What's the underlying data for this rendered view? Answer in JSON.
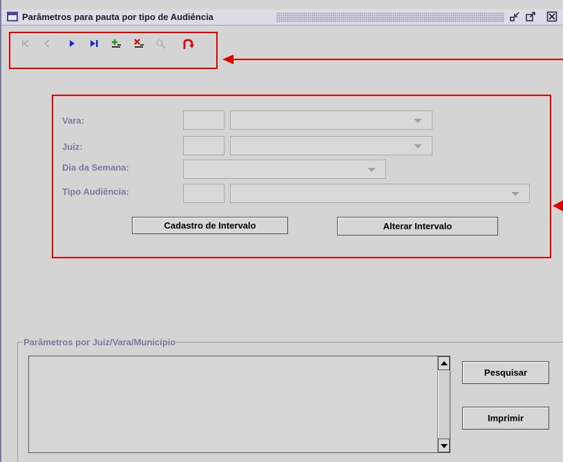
{
  "window": {
    "title": "Parâmetros para pauta por tipo de Audiência",
    "controls": [
      "minimize-icon",
      "maximize-icon",
      "close-icon"
    ]
  },
  "toolbar": {
    "buttons": [
      {
        "name": "first-record",
        "icon": "first-icon",
        "enabled": false
      },
      {
        "name": "previous-record",
        "icon": "previous-icon",
        "enabled": false
      },
      {
        "name": "next-record",
        "icon": "next-icon",
        "enabled": true
      },
      {
        "name": "last-record",
        "icon": "last-icon",
        "enabled": true
      },
      {
        "name": "add-record",
        "icon": "add-icon",
        "enabled": true
      },
      {
        "name": "delete-record",
        "icon": "delete-icon",
        "enabled": true
      },
      {
        "name": "search-record",
        "icon": "search-icon",
        "enabled": false
      },
      {
        "name": "undo",
        "icon": "undo-icon",
        "enabled": true
      }
    ]
  },
  "form": {
    "vara_label": "Vara:",
    "juiz_label": "Juiz:",
    "dia_label": "Dia da Semana:",
    "tipo_label": "Tipo Audiência:",
    "vara_code": "",
    "vara_value": "",
    "juiz_code": "",
    "juiz_value": "",
    "dia_value": "",
    "tipo_code": "",
    "tipo_value": "",
    "cadastro_button": "Cadastro de Intervalo",
    "alterar_button": "Alterar Intervalo"
  },
  "group": {
    "legend": "Parâmetros por Juiz/Vara/Município",
    "pesquisar_button": "Pesquisar",
    "imprimir_button": "Imprimir",
    "list_items": []
  },
  "annotation_color": "#e00000"
}
